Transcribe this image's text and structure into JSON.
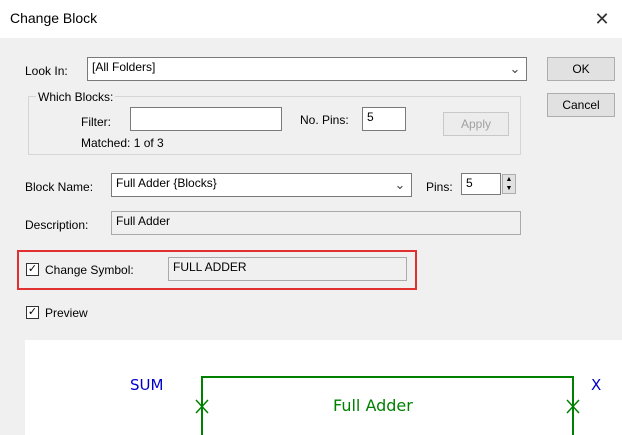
{
  "window": {
    "title": "Change Block",
    "close_glyph": "✕"
  },
  "look_in": {
    "label": "Look In:",
    "value": "[All Folders]"
  },
  "which_blocks": {
    "legend": "Which Blocks:",
    "filter_label": "Filter:",
    "filter_value": "",
    "no_pins_label": "No. Pins:",
    "no_pins_value": "5",
    "apply_label": "Apply",
    "matched_text": "Matched: 1 of 3"
  },
  "block_name": {
    "label": "Block Name:",
    "value": "Full Adder {Blocks}",
    "pins_label": "Pins:",
    "pins_value": "5"
  },
  "description": {
    "label": "Description:",
    "value": "Full Adder"
  },
  "change_symbol": {
    "label": "Change Symbol:",
    "checked": true,
    "value": "FULL ADDER"
  },
  "preview": {
    "label": "Preview",
    "checked": true,
    "symbol": {
      "name": "Full Adder",
      "left_pin": "SUM",
      "right_pin": "X",
      "line_color": "#008000",
      "pin_color": "#0000cc"
    }
  },
  "buttons": {
    "ok": "OK",
    "cancel": "Cancel"
  },
  "icons": {
    "close": "close-icon",
    "dropdown": "chevron-down-icon",
    "check": "checkmark-icon"
  },
  "colors": {
    "highlight": "#e03030"
  }
}
